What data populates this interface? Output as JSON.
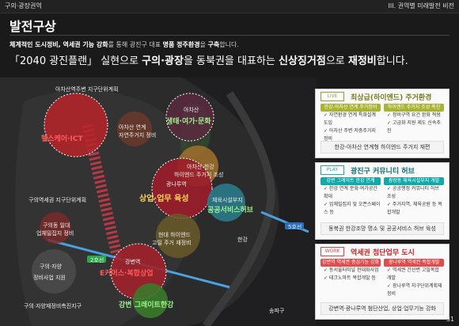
{
  "header": {
    "left": "구의·광장권역",
    "right": "III. 권역별 미래발전 비전"
  },
  "page": {
    "title": "발전구상",
    "subtitle_parts": [
      "체계적인 도시정비, 역세권 기능 강화",
      "를 통해 광진구 대표 ",
      "명품 정주환경",
      "을 ",
      "구축",
      "합니다."
    ],
    "headline_parts": [
      "「2040 광진플랜」 실현으로 ",
      "구의·광장",
      "을 동북권을 대표하는 ",
      "신상징거점",
      "으로 ",
      "재정비",
      "합니다."
    ]
  },
  "map": {
    "labels": {
      "top_plan": "아차산역주변 지구단위계획",
      "zone_a": "헬스케어·ICT",
      "achasan": "아차산",
      "achasan_sub": "생태·여가·문화",
      "achasan_mid": "아차산 연계",
      "achasan_mid2": "자연주거지 정비",
      "right_mid": "아차산-한강",
      "right_mid2": "하이엔드 주거지 조성",
      "center_name": "광나루역",
      "center": "상업·업무 육성",
      "right_low": "체육시설부지",
      "right_low2": "공공서비스허브",
      "left_plan": "구의역세권 지구단위계획",
      "left_small": "구의동 일대",
      "left_small2": "업체밀집지 정비",
      "hangang": "한강",
      "mid_low": "현대 하이엔드",
      "mid_low2": "고밀 주거 재정비",
      "bottom_center": "강변역",
      "zone_b": "E커머스·복합상업",
      "bottom_left": "구의·자양",
      "bottom_left2": "정비사업 지원",
      "bottom_left3": "구의·자양재정비촉진지구",
      "bottom_green": "강변 그레이트한강",
      "road": "5호선",
      "line2": "2호선",
      "songpa": "송파구"
    }
  },
  "panels": [
    {
      "tag": "LIVE",
      "title": "최상급(하이엔드) 주거환경",
      "col1_head": "한강-아차산 연계 주거정비",
      "col1_items": [
        "자연환경 연계 특화설계 도입",
        "아차산 주변 저층주거지 정비"
      ],
      "col2_head": "하이엔드 주거지 조성 촉진",
      "col2_items": [
        "정비구역 요건 완화 적용",
        "고급화 지원 제도 신속추진"
      ],
      "summary": "한강-아차산 연계형 하이엔드 주거지 재편"
    },
    {
      "tag": "PLAY",
      "title": "광진구 커뮤니티 허브",
      "col1_head": "강변 그레이트 한강 연계",
      "col1_items": [
        "한강 연계 문화·여가공간 확대",
        "업체밀집지 및 오픈스페이스 등"
      ],
      "col2_head": "광장동 체육시설부지 개발",
      "col2_items": [
        "공공행정 커뮤니티 허브 조성",
        "주거지역, 체육공원 등 복합개발"
      ],
      "summary": "동북권 한강조망 명소 및 공공서비스 허브 육성"
    },
    {
      "tag": "WORK",
      "title": "역세권 첨단업무 도시",
      "col1_head": "강변역 역세권 중심기능 강화",
      "col1_items": [
        "동서울터미널 현대화사업",
        "테크노마트 복합개발 등"
      ],
      "col2_head": "광나루역 역세권 복합개발",
      "col2_items": [
        "역세권 간선변 고밀복합 개발",
        "광나루역 지구단위계획재정비"
      ],
      "summary": "강변역·광나루역 첨단산업, 상업·업무기능 강화"
    }
  ],
  "page_number": "31",
  "colors": {
    "live": "#a8b42f",
    "play": "#12aaa8",
    "work": "#e44b4b",
    "zone_red": "#b8242a",
    "zone_yellow": "#c9a92a"
  }
}
